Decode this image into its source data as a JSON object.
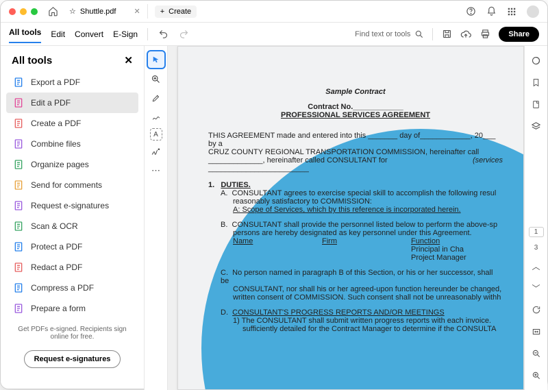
{
  "titlebar": {
    "filename": "Shuttle.pdf",
    "create_label": "Create"
  },
  "toolbar": {
    "tabs": [
      "All tools",
      "Edit",
      "Convert",
      "E-Sign"
    ],
    "find_label": "Find text or tools",
    "share_label": "Share"
  },
  "sidebar": {
    "title": "All tools",
    "items": [
      {
        "label": "Export a PDF",
        "color": "#2680eb"
      },
      {
        "label": "Edit a PDF",
        "color": "#e34999",
        "active": true
      },
      {
        "label": "Create a PDF",
        "color": "#e66060"
      },
      {
        "label": "Combine files",
        "color": "#9b5cde"
      },
      {
        "label": "Organize pages",
        "color": "#39a564"
      },
      {
        "label": "Send for comments",
        "color": "#e8a23d"
      },
      {
        "label": "Request e-signatures",
        "color": "#9b5cde"
      },
      {
        "label": "Scan & OCR",
        "color": "#39a564"
      },
      {
        "label": "Protect a PDF",
        "color": "#2680eb"
      },
      {
        "label": "Redact a PDF",
        "color": "#e66060"
      },
      {
        "label": "Compress a PDF",
        "color": "#2680eb"
      },
      {
        "label": "Prepare a form",
        "color": "#9b5cde"
      }
    ],
    "footer_text": "Get PDFs e-signed. Recipients sign online for free.",
    "cta_label": "Request e-signatures"
  },
  "page_numbers": {
    "current": "1",
    "total": "3"
  },
  "document": {
    "sample": "Sample Contract",
    "contract_no": "Contract No.____________",
    "title": "PROFESSIONAL SERVICES AGREEMENT",
    "para1a": "THIS AGREEMENT made and entered into this _______ day of____________, 20___ by a",
    "para1b": "CRUZ COUNTY REGIONAL TRANSPORTATION COMMISSION, hereinafter call",
    "para1c": "_____________, hereinafter called CONSULTANT for ________________________",
    "para1d": "(services",
    "sec1": "1.",
    "sec1_title": "DUTIES.",
    "a_label": "A.",
    "a_text1": "CONSULTANT agrees to exercise special skill to accomplish the following resul",
    "a_text2": "reasonably satisfactory to COMMISSION:",
    "a_text3": "A: Scope of Services, which by this reference is incorporated herein.",
    "b_label": "B.",
    "b_text1": "CONSULTANT shall provide the personnel listed below to perform the above-sp",
    "b_text2": "persons are hereby designated as key personnel under this Agreement.",
    "col1": "Name",
    "col2": "Firm",
    "col3": "Function",
    "row2": "Principal in Cha",
    "row3": "Project Manager",
    "c_label": "C.",
    "c_text1": "No person named in paragraph B of this Section, or his or her successor, shall be",
    "c_text2": "CONSULTANT, nor shall his or her agreed-upon function hereunder be changed,",
    "c_text3": "written consent of COMMISSION.  Such consent shall not be unreasonably withh",
    "d_label": "D.",
    "d_title": "CONSULTANT'S PROGRESS REPORTS AND/OR MEETINGS",
    "d_text1": "1)   The CONSULTANT shall submit written progress reports with each invoice.",
    "d_text2": "sufficiently detailed for the Contract Manager to determine if the CONSULTA"
  }
}
